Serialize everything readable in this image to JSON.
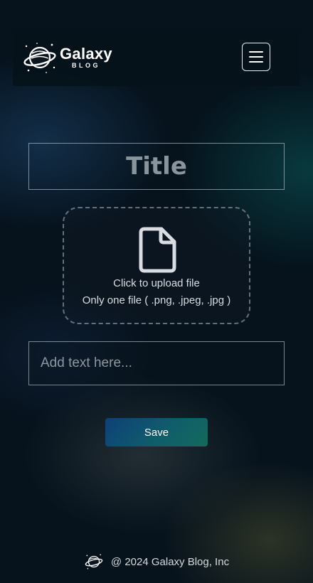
{
  "header": {
    "logo_icon": "galaxy-planet-icon",
    "brand_name": "Galaxy",
    "brand_sub": "BLOG",
    "menu_icon": "hamburger-menu-icon"
  },
  "form": {
    "title_placeholder": "Title",
    "upload": {
      "icon": "file-icon",
      "primary_text": "Click to upload file",
      "secondary_text": "Only one file ( .png, .jpeg, .jpg )"
    },
    "text_placeholder": "Add text here...",
    "save_label": "Save"
  },
  "footer": {
    "logo_icon": "galaxy-planet-icon",
    "copyright": "@ 2024 Galaxy Blog, Inc"
  },
  "colors": {
    "background": "#06121c",
    "navbar": "#05121a",
    "button_gradient_start": "#0f3f78",
    "button_gradient_end": "#136a5a",
    "title_text": "#8a949c"
  }
}
